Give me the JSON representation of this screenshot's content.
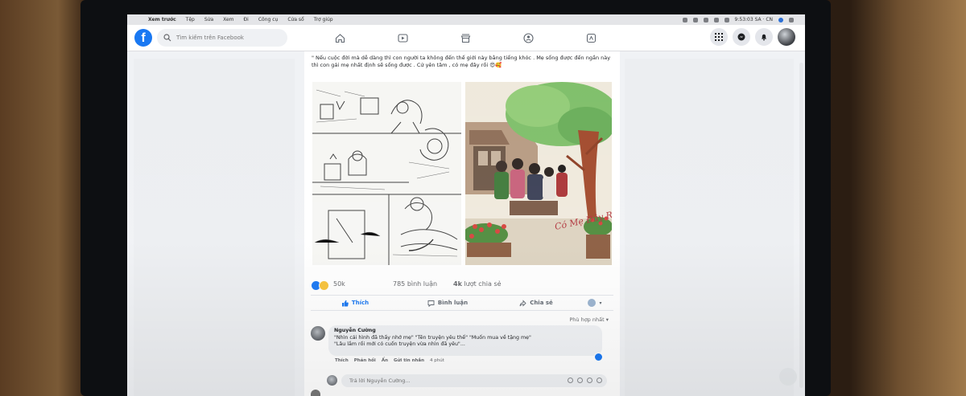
{
  "menubar": {
    "apple": "",
    "items": [
      "Xem trước",
      "Tệp",
      "Sửa",
      "Xem",
      "Đi",
      "Công cụ",
      "Cửa sổ",
      "Trợ giúp"
    ],
    "clock": "9:53:03 SA · CN"
  },
  "facebook": {
    "logo": "f",
    "search_placeholder": "Tìm kiếm trên Facebook",
    "nav_icons": [
      "home-icon",
      "watch-icon",
      "marketplace-icon",
      "groups-icon",
      "gaming-icon"
    ],
    "right_icons": [
      "menu-grid-icon",
      "messenger-icon",
      "notifications-icon",
      "profile-avatar"
    ]
  },
  "post": {
    "text": "\" Nếu cuộc đời mà dễ dàng thì con người ta không đến thế giới này bằng tiếng khóc . Mẹ sống được đến ngần này thì con gái mẹ nhất định sẽ sống được . Cứ yên tâm , có mẹ đây rồi 😍🥰",
    "painting_caption": "Có Mẹ Đây Rồi !!!",
    "reaction_count": "50k",
    "comments_count": "785 bình luận",
    "shares_count_strong": "4k",
    "shares_count_rest": " lượt chia sẻ",
    "actions": {
      "like": "Thích",
      "comment": "Bình luận",
      "share": "Chia sẻ"
    },
    "sort_label": "Phù hợp nhất"
  },
  "comment": {
    "author": "Nguyễn Cường",
    "lines": [
      "\"Nhìn cái hình đã thấy nhớ mẹ\" \"Tên truyện yêu thế\" \"Muốn mua về tặng mẹ\"",
      "\"Lâu lắm rồi mới có cuốn truyện vừa nhìn đã yêu\"..."
    ],
    "meta": {
      "like": "Thích",
      "reply": "Phản hồi",
      "hide": "Ẩn",
      "send": "Gửi tin nhắn",
      "time": "4 phút"
    }
  },
  "reply": {
    "placeholder": "Trả lời Nguyễn Cường..."
  },
  "colors": {
    "fb_blue": "#1877f2",
    "bg": "#f0f2f5"
  }
}
